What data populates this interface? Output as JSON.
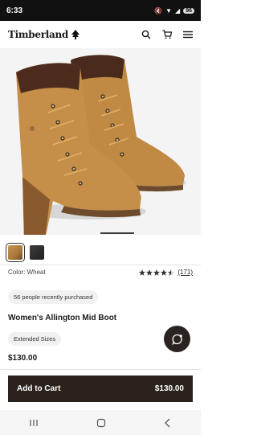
{
  "status": {
    "time": "6:33",
    "battery": "96"
  },
  "header": {
    "brand": "Timberland"
  },
  "colors": {
    "wheat": "#b5833b",
    "black": "#2e2e2e",
    "cta": "#2b221c"
  },
  "product": {
    "color_label": "Color: Wheat",
    "rating": 4.5,
    "review_count": "(171)",
    "recent_purchase": "56 people recently purchased",
    "title": "Women's Allington Mid Boot",
    "sizes_label": "Extended Sizes",
    "price": "$130.00"
  },
  "cart": {
    "label": "Add to Cart",
    "price": "$130.00"
  }
}
